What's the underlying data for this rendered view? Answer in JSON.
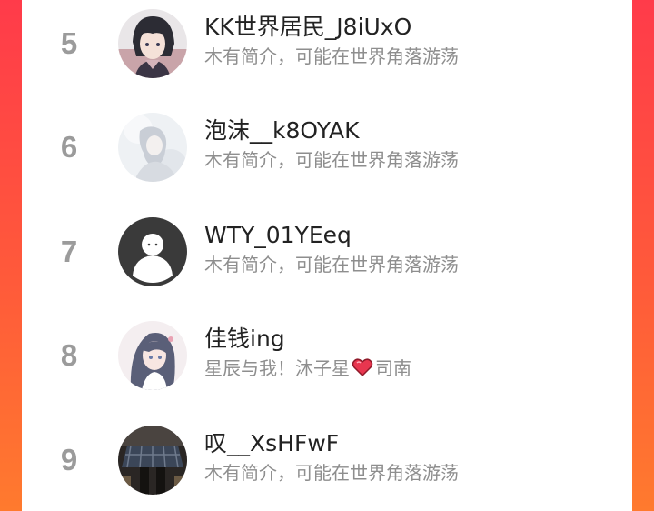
{
  "rank_list": {
    "items": [
      {
        "rank": "5",
        "username": "KK世界居民_J8iUxO",
        "bio": "木有简介，可能在世界角落游荡",
        "avatar": "anime-boy-avatar"
      },
      {
        "rank": "6",
        "username": "泡沫__k8OYAK",
        "bio": "木有简介，可能在世界角落游荡",
        "avatar": "pale-anime-girl-avatar"
      },
      {
        "rank": "7",
        "username": "WTY_01YEeq",
        "bio": "木有简介，可能在世界角落游荡",
        "avatar": "default-user-avatar"
      },
      {
        "rank": "8",
        "username": "佳钱ing",
        "bio_before": "星辰与我！沐子星",
        "bio_icon": "red-heart-icon",
        "bio_after": "司南",
        "avatar": "anime-girl-avatar"
      },
      {
        "rank": "9",
        "username": "叹__XsHFwF",
        "bio": "木有简介，可能在世界角落游荡",
        "avatar": "plaid-skirt-photo-avatar"
      }
    ]
  },
  "colors": {
    "background_top": "#ff3b4a",
    "background_bottom": "#ff7a2e",
    "rank_gray": "#9b9b9b",
    "username": "#222222",
    "bio_gray": "#8e8e8e",
    "heart": "#e8364f"
  }
}
